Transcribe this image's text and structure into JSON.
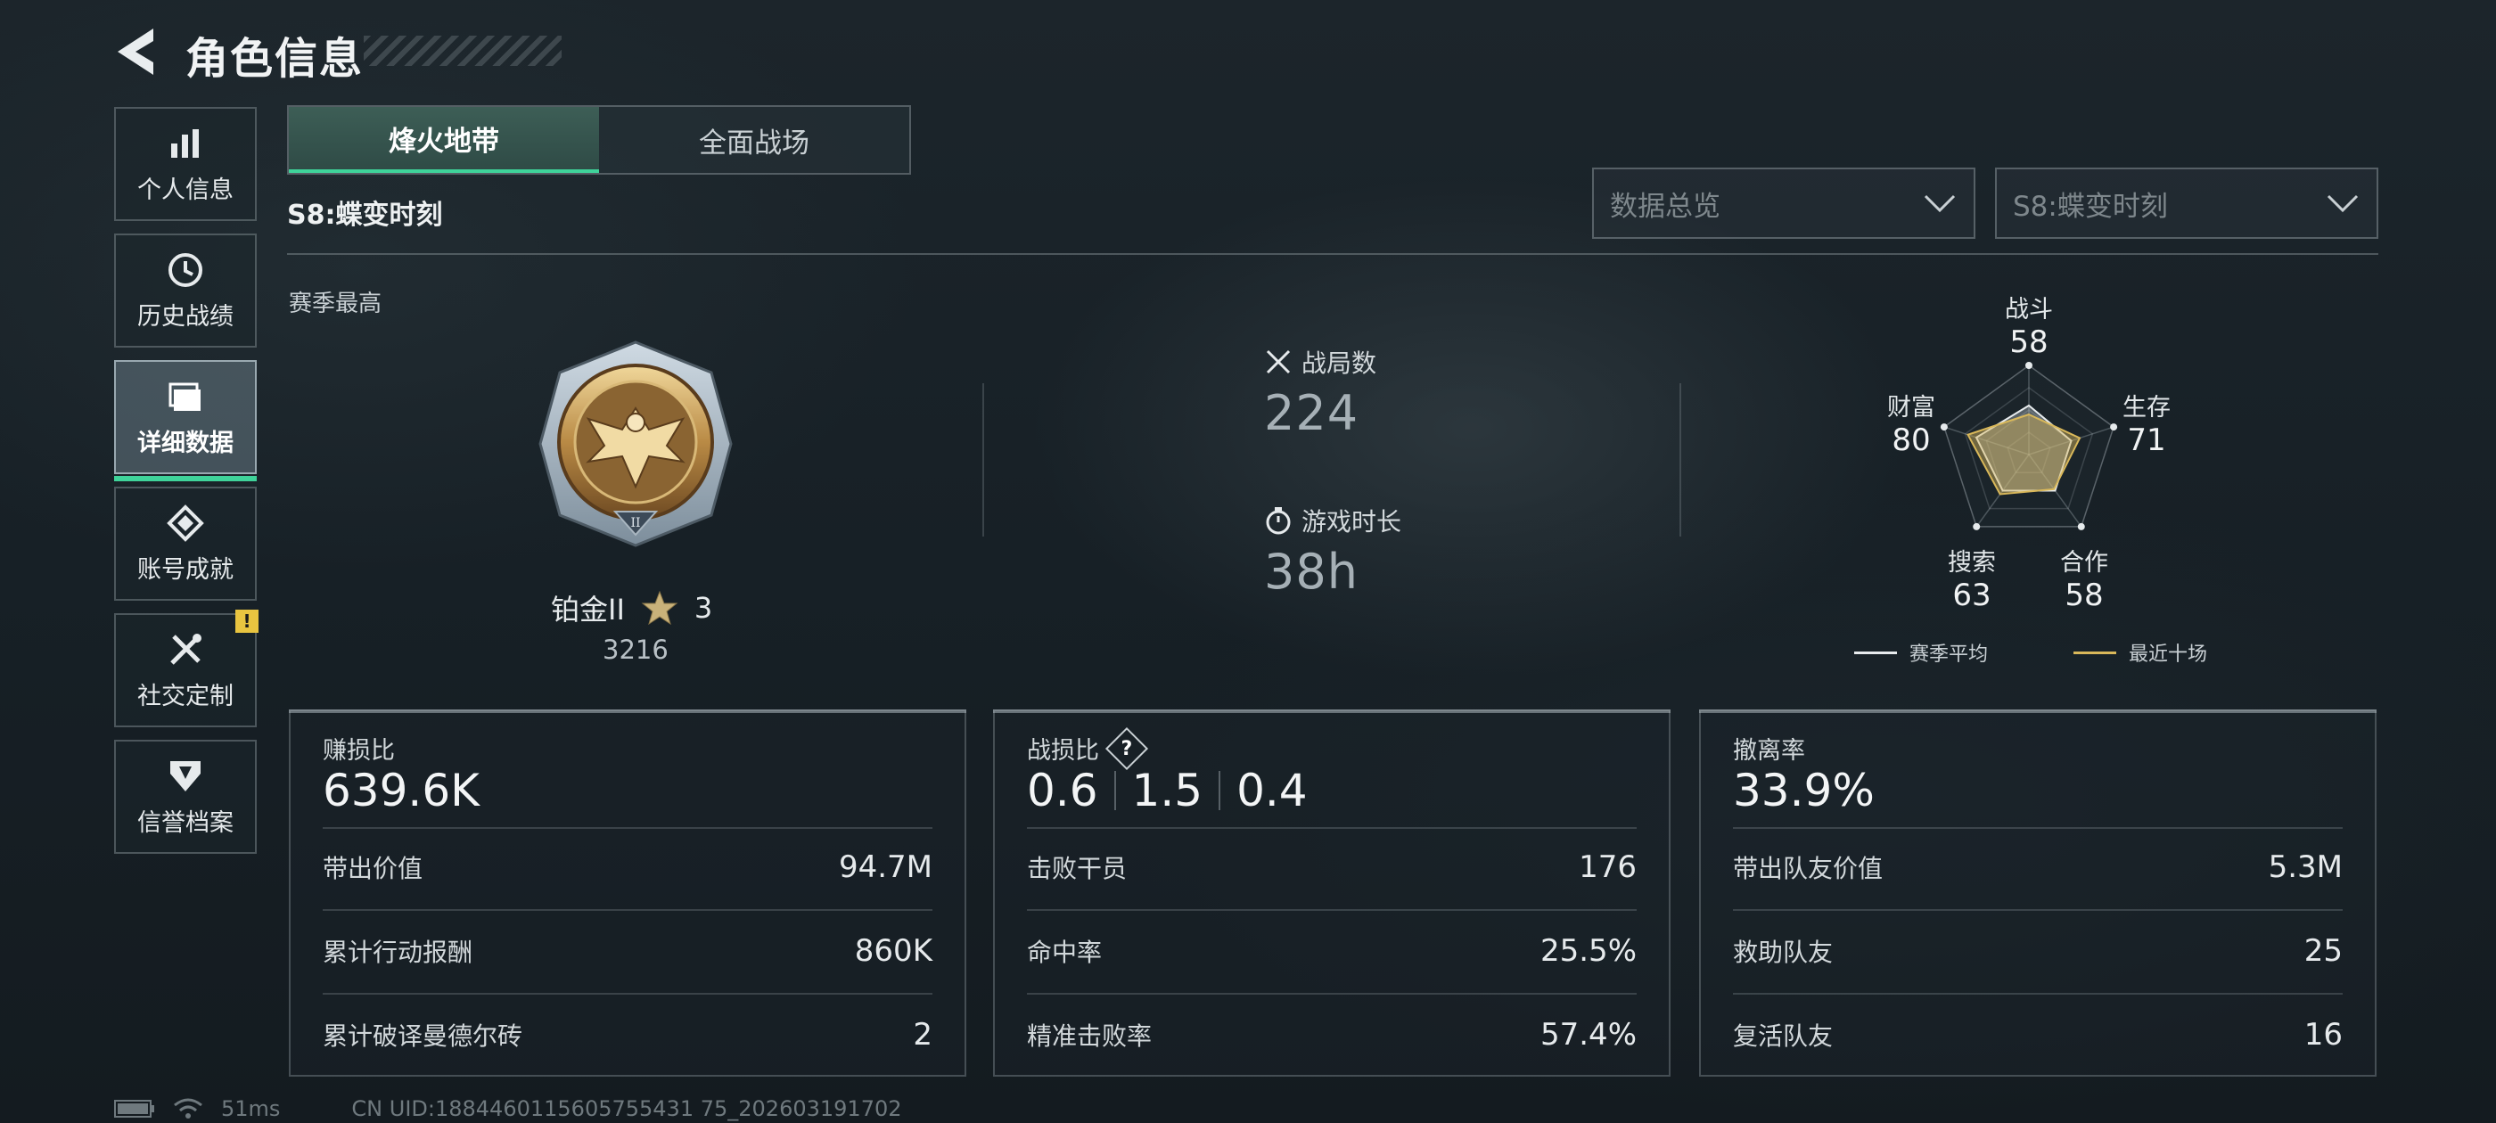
{
  "header": {
    "title": "角色信息"
  },
  "sidebar": {
    "items": [
      {
        "label": "个人信息",
        "icon": "bar-chart-icon"
      },
      {
        "label": "历史战绩",
        "icon": "history-icon"
      },
      {
        "label": "详细数据",
        "icon": "folder-icon",
        "active": true
      },
      {
        "label": "账号成就",
        "icon": "achievement-icon"
      },
      {
        "label": "社交定制",
        "icon": "tools-icon",
        "badge": "!"
      },
      {
        "label": "信誉档案",
        "icon": "shield-badge-icon"
      }
    ]
  },
  "tabs": [
    {
      "label": "烽火地带",
      "active": true
    },
    {
      "label": "全面战场",
      "active": false
    }
  ],
  "season": {
    "title": "S8:蝶变时刻"
  },
  "filters": {
    "data_type": "数据总览",
    "season": "S8:蝶变时刻"
  },
  "season_best": {
    "label": "赛季最高",
    "rank": "铂金II",
    "stars": "3",
    "score": "3216"
  },
  "summary": {
    "battles_label": "战局数",
    "battles": "224",
    "playtime_label": "游戏时长",
    "playtime": "38h"
  },
  "radar": {
    "axes": [
      {
        "label": "战斗",
        "value": "58"
      },
      {
        "label": "生存",
        "value": "71"
      },
      {
        "label": "合作",
        "value": "58"
      },
      {
        "label": "搜索",
        "value": "63"
      },
      {
        "label": "财富",
        "value": "80"
      }
    ],
    "season_avg": [
      0.55,
      0.5,
      0.5,
      0.5,
      0.62
    ],
    "recent_ten": [
      0.45,
      0.6,
      0.48,
      0.55,
      0.72
    ],
    "legend": {
      "season_avg": "赛季平均",
      "recent_ten": "最近十场"
    },
    "colors": {
      "season_avg": "#e8ecee",
      "recent_ten": "#d9b85a"
    }
  },
  "cards": [
    {
      "title": "赚损比",
      "big": "639.6K",
      "rows": [
        {
          "label": "带出价值",
          "value": "94.7M"
        },
        {
          "label": "累计行动报酬",
          "value": "860K"
        },
        {
          "label": "累计破译曼德尔砖",
          "value": "2"
        }
      ]
    },
    {
      "title": "战损比",
      "big_parts": [
        "0.6",
        "1.5",
        "0.4"
      ],
      "help": "?",
      "rows": [
        {
          "label": "击败干员",
          "value": "176"
        },
        {
          "label": "命中率",
          "value": "25.5%"
        },
        {
          "label": "精准击败率",
          "value": "57.4%"
        }
      ]
    },
    {
      "title": "撤离率",
      "big": "33.9%",
      "rows": [
        {
          "label": "带出队友价值",
          "value": "5.3M"
        },
        {
          "label": "救助队友",
          "value": "25"
        },
        {
          "label": "复活队友",
          "value": "16"
        }
      ]
    }
  ],
  "footer": {
    "ping": "51ms",
    "uid": "CN UID:1884460115605755431 75_202603191702"
  },
  "colors": {
    "accent": "#3fd39a",
    "badge": "#e8c440"
  }
}
